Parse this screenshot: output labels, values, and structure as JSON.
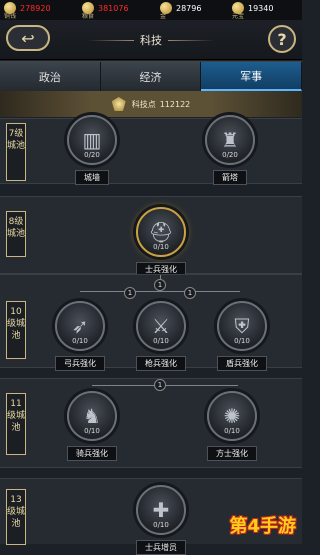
{
  "topbar": {
    "res1": {
      "label": "铜钱",
      "value": "278920"
    },
    "res2": {
      "label": "粮食",
      "value": "381076"
    },
    "res3": {
      "label": "金",
      "value": "28796"
    },
    "res4": {
      "label": "元宝",
      "value": "19340"
    }
  },
  "header": {
    "title": "科技",
    "help": "?"
  },
  "tabs": [
    "政治",
    "经济",
    "军事"
  ],
  "active_tab": "军事",
  "points": {
    "label": "科技点",
    "value": "112122"
  },
  "sections": {
    "s7": {
      "level": "7级城池",
      "nodes": [
        {
          "name": "城墙",
          "progress": "0/20"
        },
        {
          "name": "箭塔",
          "progress": "0/20"
        }
      ]
    },
    "s8": {
      "level": "8级城池",
      "nodes": [
        {
          "name": "士兵强化",
          "progress": "0/10"
        }
      ]
    },
    "s10": {
      "level": "10级城池",
      "nodes": [
        {
          "name": "弓兵强化",
          "progress": "0/10"
        },
        {
          "name": "枪兵强化",
          "progress": "0/10"
        },
        {
          "name": "盾兵强化",
          "progress": "0/10"
        }
      ],
      "connectors": [
        "1",
        "1",
        "1"
      ]
    },
    "s11": {
      "level": "11级城池",
      "nodes": [
        {
          "name": "骑兵强化",
          "progress": "0/10"
        },
        {
          "name": "方士强化",
          "progress": "0/10"
        }
      ],
      "connectors": [
        "1"
      ]
    },
    "s13": {
      "level": "13级城池",
      "nodes": [
        {
          "name": "士兵增员",
          "progress": "0/10"
        }
      ]
    }
  },
  "watermark": "第4手游"
}
